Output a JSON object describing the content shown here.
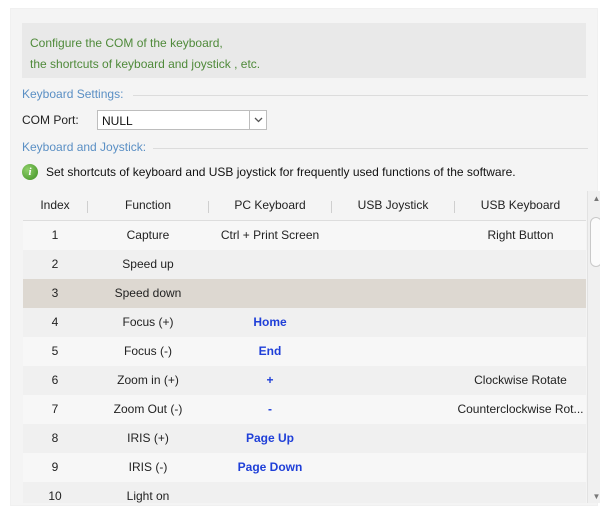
{
  "banner": {
    "line1": "Configure the COM of the keyboard,",
    "line2": "the shortcuts of keyboard and joystick , etc."
  },
  "keyboard_settings": {
    "section_label": "Keyboard Settings:",
    "com_port_label": "COM Port:",
    "com_port_value": "NULL"
  },
  "keyboard_joystick": {
    "section_label": "Keyboard and Joystick:",
    "info_text": "Set shortcuts of keyboard and USB joystick for frequently used functions of the software."
  },
  "table": {
    "columns": [
      "Index",
      "Function",
      "PC Keyboard",
      "USB Joystick",
      "USB Keyboard"
    ],
    "rows": [
      {
        "index": "1",
        "function": "Capture",
        "pc_keyboard": "Ctrl + Print Screen",
        "usb_joystick": "",
        "usb_keyboard": "Right Button"
      },
      {
        "index": "2",
        "function": "Speed up",
        "pc_keyboard": "",
        "usb_joystick": "",
        "usb_keyboard": ""
      },
      {
        "index": "3",
        "function": "Speed down",
        "pc_keyboard": "",
        "usb_joystick": "",
        "usb_keyboard": ""
      },
      {
        "index": "4",
        "function": "Focus (+)",
        "pc_keyboard": "Home",
        "usb_joystick": "",
        "usb_keyboard": ""
      },
      {
        "index": "5",
        "function": "Focus (-)",
        "pc_keyboard": "End",
        "usb_joystick": "",
        "usb_keyboard": ""
      },
      {
        "index": "6",
        "function": "Zoom in (+)",
        "pc_keyboard": "+",
        "usb_joystick": "",
        "usb_keyboard": "Clockwise Rotate"
      },
      {
        "index": "7",
        "function": "Zoom Out (-)",
        "pc_keyboard": "-",
        "usb_joystick": "",
        "usb_keyboard": "Counterclockwise Rot..."
      },
      {
        "index": "8",
        "function": "IRIS (+)",
        "pc_keyboard": "Page Up",
        "usb_joystick": "",
        "usb_keyboard": ""
      },
      {
        "index": "9",
        "function": "IRIS (-)",
        "pc_keyboard": "Page Down",
        "usb_joystick": "",
        "usb_keyboard": ""
      },
      {
        "index": "10",
        "function": "Light on",
        "pc_keyboard": "",
        "usb_joystick": "",
        "usb_keyboard": ""
      }
    ],
    "selected_row_index": "3",
    "highlight_pc_keys": [
      "Home",
      "End",
      "+",
      "-",
      "Page Up",
      "Page Down"
    ]
  },
  "icons": {
    "info": "info-icon",
    "dropdown": "chevron-down-icon",
    "scroll_up": "scroll-up-icon",
    "scroll_down": "scroll-down-icon"
  },
  "colors": {
    "banner_text": "#4f8a3a",
    "section_label": "#5a8fc4",
    "key_highlight": "#1f3fd8",
    "selected_row": "#ddd8d1"
  }
}
